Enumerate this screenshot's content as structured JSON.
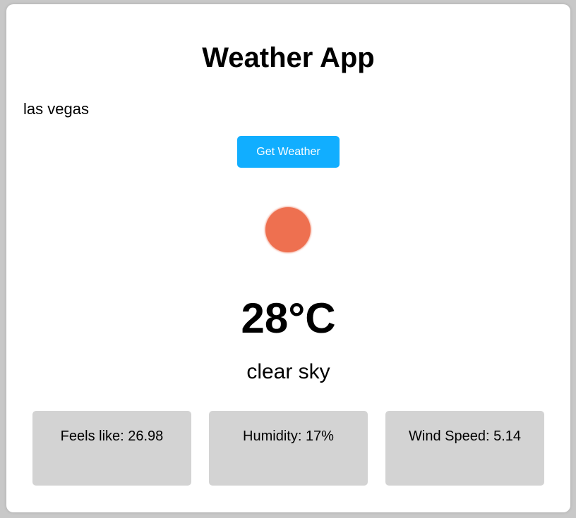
{
  "app": {
    "title": "Weather App"
  },
  "search": {
    "value": "las vegas",
    "button_label": "Get Weather"
  },
  "weather": {
    "icon": "sun-icon",
    "icon_color": "#ee7050",
    "temperature": "28°C",
    "description": "clear sky"
  },
  "details": {
    "feels_like": "Feels like: 26.98",
    "humidity": "Humidity: 17%",
    "wind_speed": "Wind Speed: 5.14"
  },
  "colors": {
    "accent": "#11aeff",
    "card_bg": "#d3d3d3"
  }
}
